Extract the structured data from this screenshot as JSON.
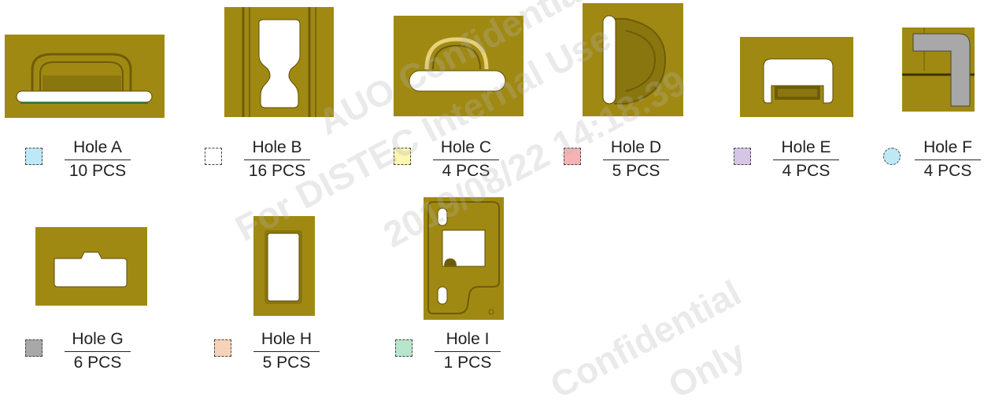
{
  "colors": {
    "plate": "#a08912",
    "plate_dark": "#6e5d08",
    "plate_edge": "#8a760e",
    "hole_fill": "#ffffff",
    "grey_part": "#a8a8a8"
  },
  "watermark": {
    "lines": [
      "AUO Confidential Use",
      "For DISTEC Internal Use",
      "2019/08/22 14:18:39",
      "Confidential",
      "Only"
    ]
  },
  "holes": [
    {
      "name": "Hole A",
      "qty": "10 PCS",
      "swatch_color": "#bfe8f7",
      "swatch_shape": "square",
      "icon": "slot-with-arch-icon"
    },
    {
      "name": "Hole B",
      "qty": "16 PCS",
      "swatch_color": "#ffffff",
      "swatch_shape": "square",
      "icon": "keyhole-slot-icon"
    },
    {
      "name": "Hole C",
      "qty": "4 PCS",
      "swatch_color": "#fbf7b0",
      "swatch_shape": "square",
      "icon": "slot-with-dome-icon"
    },
    {
      "name": "Hole D",
      "qty": "5 PCS",
      "swatch_color": "#f7b3b3",
      "swatch_shape": "square",
      "icon": "vertical-slot-icon"
    },
    {
      "name": "Hole E",
      "qty": "4 PCS",
      "swatch_color": "#d6c6e6",
      "swatch_shape": "square",
      "icon": "notched-slot-icon"
    },
    {
      "name": "Hole F",
      "qty": "4 PCS",
      "swatch_color": "#bfe8f7",
      "swatch_shape": "circle",
      "icon": "l-bracket-icon"
    },
    {
      "name": "Hole G",
      "qty": "6 PCS",
      "swatch_color": "#a8a8a8",
      "swatch_shape": "square",
      "icon": "tabbed-rectangle-icon"
    },
    {
      "name": "Hole H",
      "qty": "5 PCS",
      "swatch_color": "#f6d3b8",
      "swatch_shape": "square",
      "icon": "tall-rectangle-icon"
    },
    {
      "name": "Hole I",
      "qty": "1 PCS",
      "swatch_color": "#b8e6cc",
      "swatch_shape": "square",
      "icon": "corner-plate-icon"
    }
  ]
}
